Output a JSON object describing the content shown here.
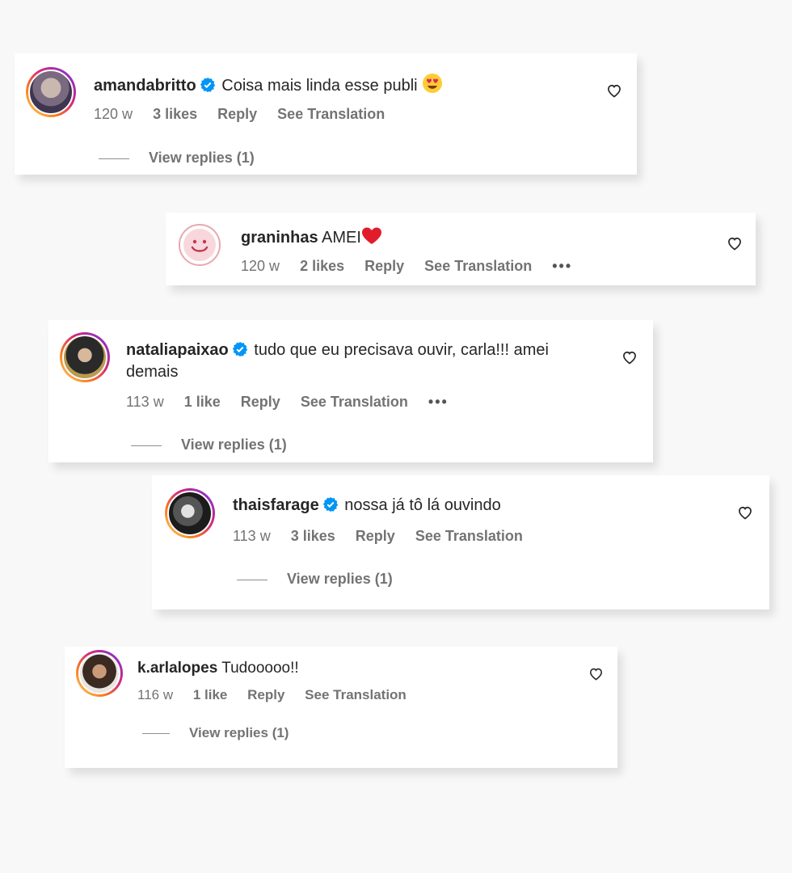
{
  "comments": [
    {
      "username": "amandabritto",
      "verified": true,
      "text": "Coisa mais linda esse publi",
      "emoji": "heart-eyes",
      "time": "120 w",
      "likes": "3 likes",
      "reply": "Reply",
      "translate": "See Translation",
      "view_replies": "View replies (1)"
    },
    {
      "username": "graninhas",
      "verified": false,
      "text": "AMEI",
      "emoji": "red-heart",
      "time": "120 w",
      "likes": "2 likes",
      "reply": "Reply",
      "translate": "See Translation",
      "more": "•••"
    },
    {
      "username": "nataliapaixao",
      "verified": true,
      "text": "tudo que eu precisava ouvir, carla!!! amei demais",
      "time": "113 w",
      "likes": "1 like",
      "reply": "Reply",
      "translate": "See Translation",
      "more": "•••",
      "view_replies": "View replies (1)"
    },
    {
      "username": "thaisfarage",
      "verified": true,
      "text": "nossa já tô lá ouvindo",
      "time": "113 w",
      "likes": "3 likes",
      "reply": "Reply",
      "translate": "See Translation",
      "view_replies": "View replies (1)"
    },
    {
      "username": "k.arlalopes",
      "verified": false,
      "text": "Tudooooo!!",
      "time": "116 w",
      "likes": "1 like",
      "reply": "Reply",
      "translate": "See Translation",
      "view_replies": "View replies (1)"
    }
  ],
  "colors": {
    "verified_blue": "#0095f6",
    "muted_text": "#737373",
    "primary_text": "#262626"
  },
  "icons": [
    "verified-badge-icon",
    "heart-outline-icon",
    "heart-eyes-emoji",
    "red-heart-emoji",
    "more-options-icon"
  ]
}
